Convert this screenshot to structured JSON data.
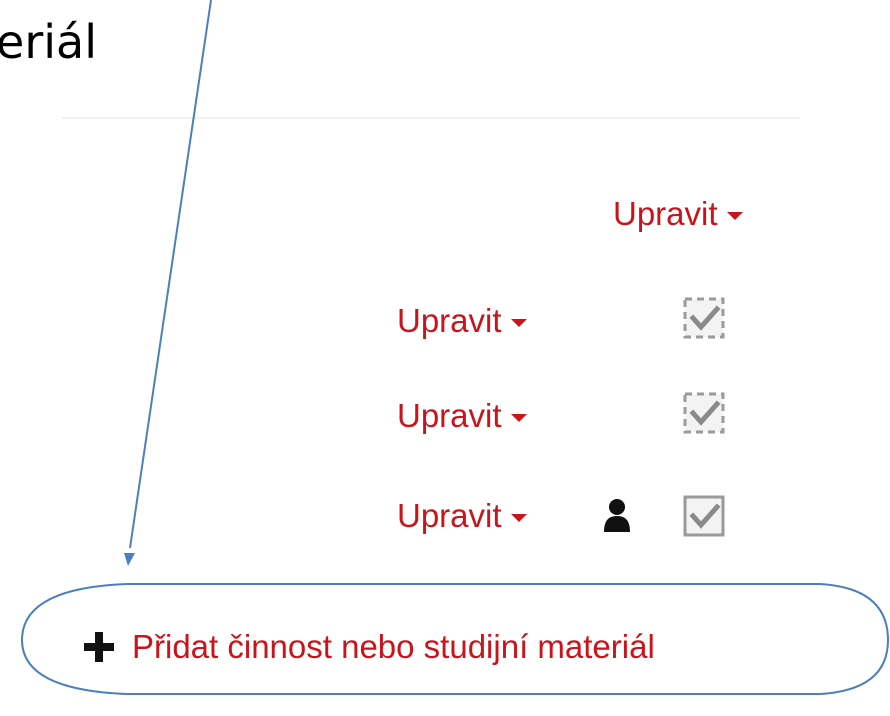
{
  "caption": {
    "text": "teriál"
  },
  "rows": {
    "section_edit": {
      "label": "Upravit"
    },
    "item_edit_1": {
      "label": "Upravit"
    },
    "item_edit_2": {
      "label": "Upravit"
    },
    "item_edit_3": {
      "label": "Upravit"
    }
  },
  "add_activity": {
    "label": "Přidat činnost nebo studijní materiál"
  },
  "colors": {
    "link": "#c9141b",
    "annotation": "#4a7fc0"
  },
  "icons": {
    "caret": "caret-down-icon",
    "completion_manual": "checkbox-dashed-icon",
    "completion_auto": "checkbox-checked-icon",
    "restricted": "user-icon",
    "add": "plus-icon"
  }
}
